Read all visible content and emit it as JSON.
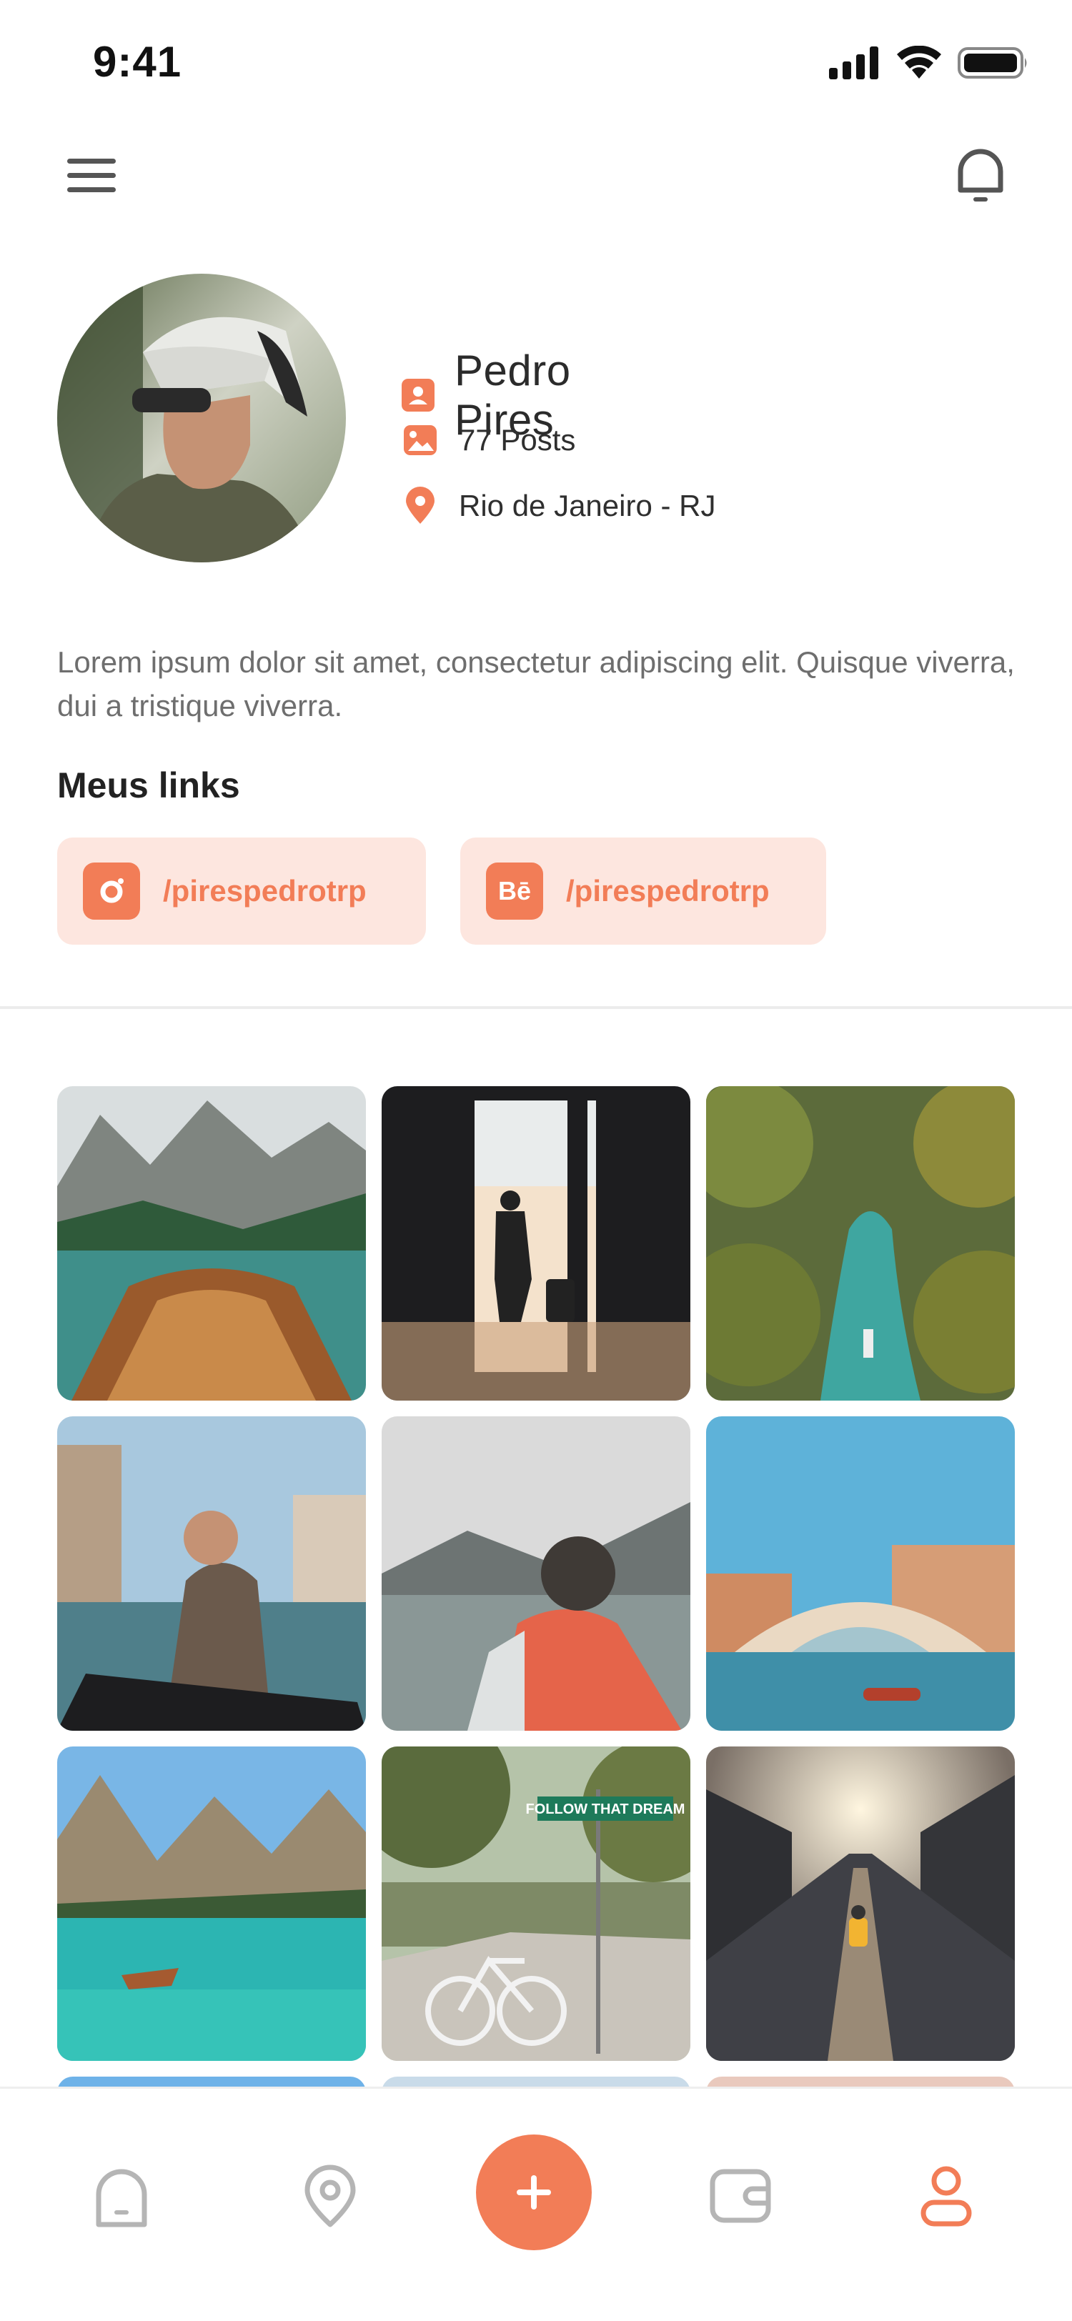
{
  "status_bar": {
    "time": "9:41"
  },
  "header": {
    "menu_icon": "hamburger-icon",
    "notification_icon": "bell-icon"
  },
  "profile": {
    "name": "Pedro Pires",
    "posts": "77 Posts",
    "location": "Rio de Janeiro -  RJ",
    "bio": "Lorem ipsum dolor sit amet, consectetur adipiscing elit. Quisque viverra, dui a tristique viverra."
  },
  "links": {
    "title": "Meus links",
    "items": [
      {
        "icon": "instagram-icon",
        "label": "/pirespedrotrp"
      },
      {
        "icon": "behance-icon",
        "icon_text": "Bē",
        "label": "/pirespedrotrp"
      }
    ]
  },
  "gallery": {
    "photos": [
      "boat-lake-mountains",
      "traveler-silhouette-airport",
      "canoe-palm-river",
      "man-gondola-venice",
      "hiker-backpack-lake",
      "rialto-bridge-venice",
      "turquoise-lake-boat",
      "bicycle-follow-that-dream",
      "suspension-bridge-sunset"
    ],
    "sign_text": "FOLLOW THAT DREAM"
  },
  "bottom_nav": {
    "items": [
      "home-icon",
      "map-pin-icon",
      "add-icon",
      "wallet-icon",
      "profile-icon"
    ],
    "active": "profile-icon"
  },
  "colors": {
    "accent": "#f27d57",
    "chip_bg": "#fde6df",
    "text": "#2b2b2b",
    "muted": "#6e6e6e"
  }
}
